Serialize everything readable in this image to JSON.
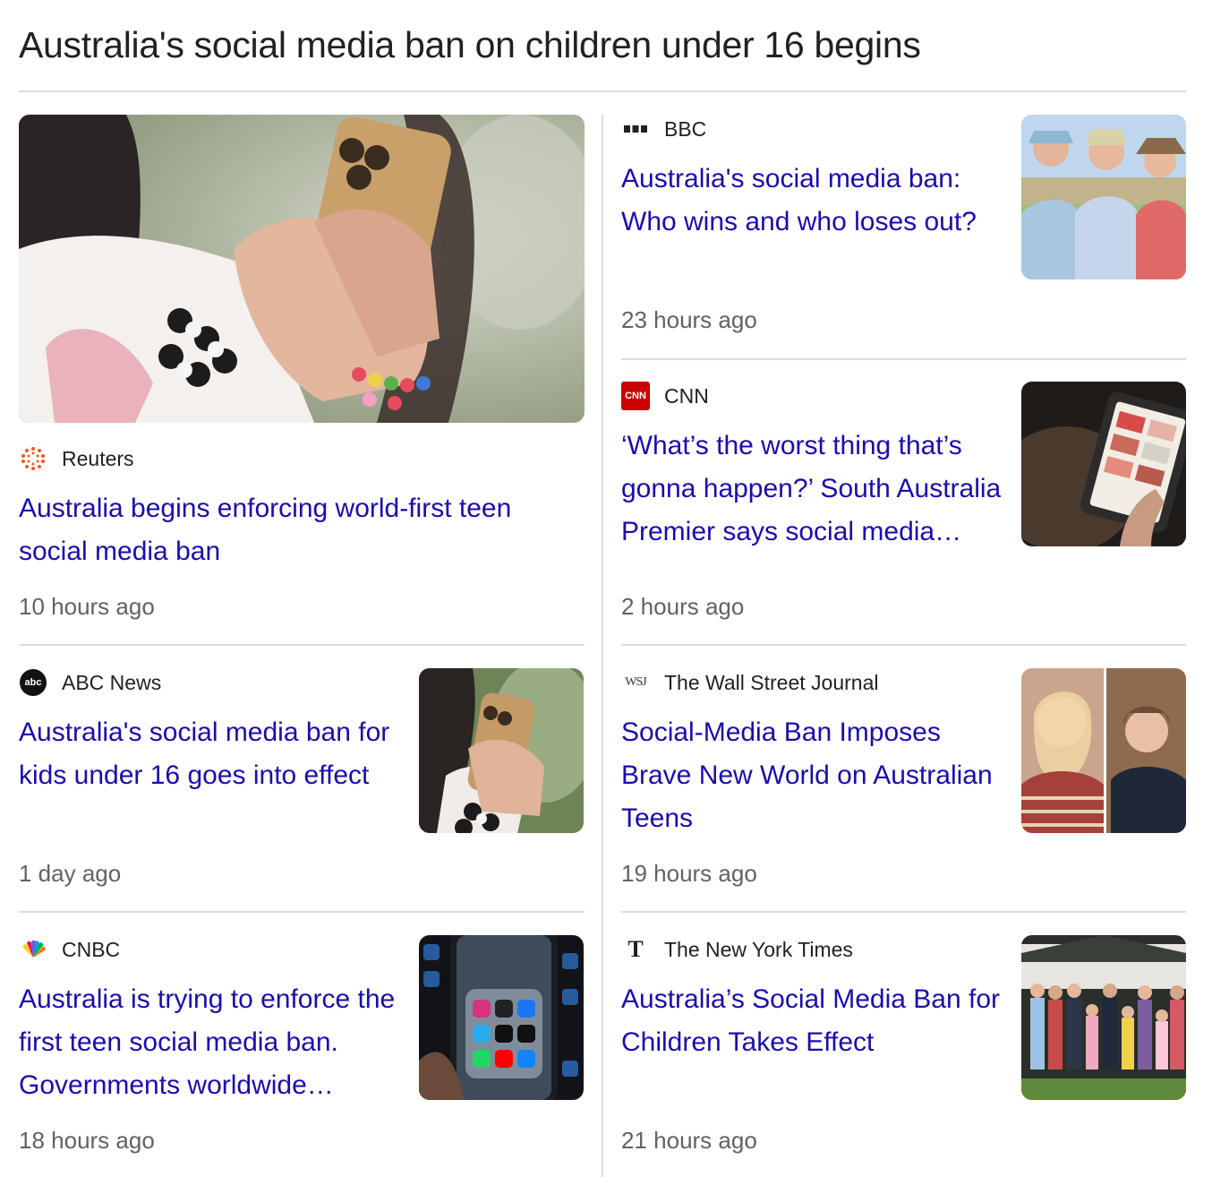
{
  "page": {
    "title": "Australia's social media ban on children under 16 begins"
  },
  "articles": [
    {
      "source": "Reuters",
      "logo_icon": "reuters-logo-icon",
      "headline": "Australia begins enforcing world-first teen social media ban",
      "time": "10 hours ago",
      "image": "girl-holding-phone-with-bracelets"
    },
    {
      "source": "BBC",
      "logo_icon": "bbc-logo-icon",
      "headline": "Australia's social media ban: Who wins and who loses out?",
      "time": "23 hours ago",
      "image": "three-people-outdoors-hats"
    },
    {
      "source": "CNN",
      "logo_icon": "cnn-logo-icon",
      "logo_text": "CNN",
      "headline": "‘What’s the worst thing that’s gonna happen?’ South Australia Premier says social media ban…",
      "time": "2 hours ago",
      "image": "child-using-tablet"
    },
    {
      "source": "ABC News",
      "logo_icon": "abc-logo-icon",
      "logo_text": "abc",
      "headline": "Australia's social media ban for kids under 16 goes into effect",
      "time": "1 day ago",
      "image": "hands-holding-phone"
    },
    {
      "source": "The Wall Street Journal",
      "logo_icon": "wsj-logo-icon",
      "logo_text": "WSJ",
      "headline": "Social-Media Ban Imposes Brave New World on Australian Teens",
      "time": "19 hours ago",
      "image": "two-teens-portraits"
    },
    {
      "source": "CNBC",
      "logo_icon": "cnbc-peacock-icon",
      "headline": "Australia is trying to enforce the first teen social media ban. Governments worldwide…",
      "time": "18 hours ago",
      "image": "phone-social-apps-folder"
    },
    {
      "source": "The New York Times",
      "logo_icon": "nyt-logo-icon",
      "logo_text": "T",
      "headline": "Australia’s Social Media Ban for Children Takes Effect",
      "time": "21 hours ago",
      "image": "group-of-families-outside-house"
    }
  ],
  "colors": {
    "headline_link": "#1a0dab",
    "divider": "#dadce0",
    "meta_text": "#5f6368",
    "cnn_red": "#cc0000"
  }
}
